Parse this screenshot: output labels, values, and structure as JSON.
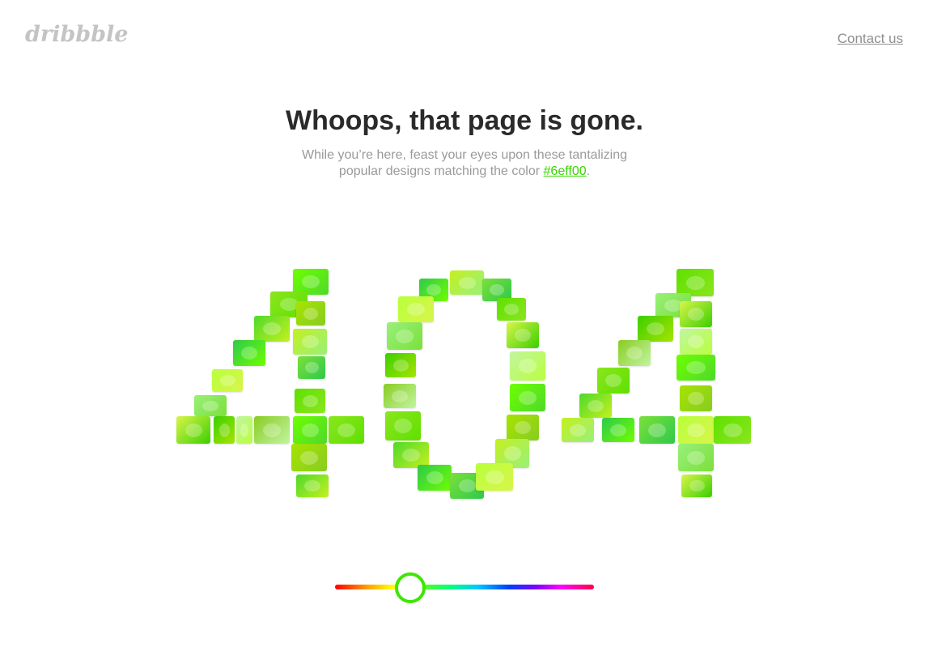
{
  "header": {
    "logo_text": "dribbble",
    "contact_label": "Contact us"
  },
  "main": {
    "title": "Whoops, that page is gone.",
    "subtitle_line1": "While you’re here, feast your eyes upon these tantalizing",
    "subtitle_line2_prefix": "popular designs matching the color ",
    "color_link": "#6eff00",
    "subtitle_end": "."
  },
  "mosaic": {
    "digits": [
      "4",
      "0",
      "4"
    ],
    "tile_count": 70
  },
  "color_slider": {
    "selected_color": "#6eff00",
    "value_percent": 29,
    "thumb_border": "#3ee600"
  },
  "colors": {
    "accent": "#6eff00",
    "link": "#38d600",
    "title": "#2a2a2a",
    "muted": "#9a9a9a",
    "logo": "#c4c4c4"
  }
}
